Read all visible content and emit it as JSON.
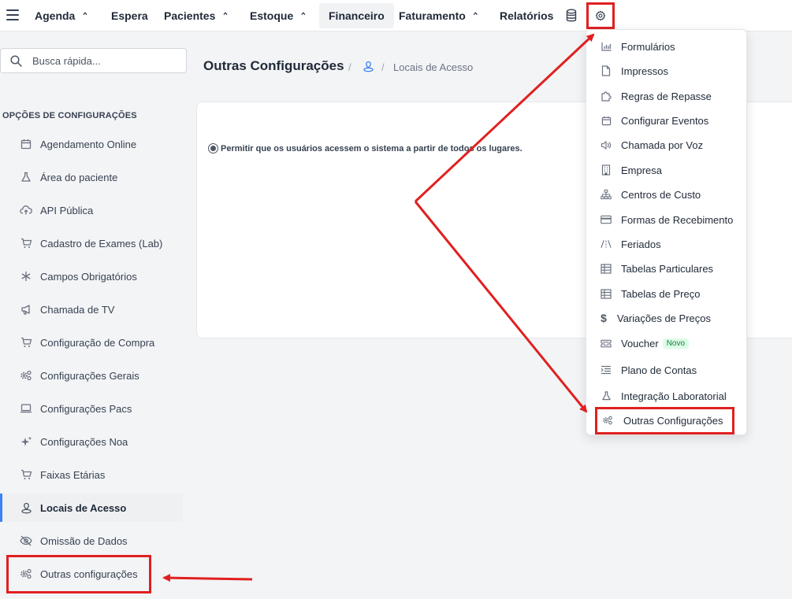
{
  "nav": {
    "items": [
      {
        "label": "Agenda",
        "chevron": true
      },
      {
        "label": "Espera",
        "chevron": false
      },
      {
        "label": "Pacientes",
        "chevron": true
      },
      {
        "label": "Estoque",
        "chevron": true
      },
      {
        "label": "Financeiro",
        "chevron": false
      },
      {
        "label": "Faturamento",
        "chevron": true
      },
      {
        "label": "Relatórios",
        "chevron": false
      }
    ],
    "active": "Financeiro"
  },
  "search": {
    "placeholder": "Busca rápida..."
  },
  "sidebar": {
    "section_title": "OPÇÕES DE CONFIGURAÇÕES",
    "items": [
      {
        "label": "Agendamento Online",
        "icon": "calendar-icon"
      },
      {
        "label": "Área do paciente",
        "icon": "flask-icon"
      },
      {
        "label": "API Pública",
        "icon": "cloud-upload-icon"
      },
      {
        "label": "Cadastro de Exames (Lab)",
        "icon": "cart-icon"
      },
      {
        "label": "Campos Obrigatórios",
        "icon": "asterisk-icon"
      },
      {
        "label": "Chamada de TV",
        "icon": "megaphone-icon"
      },
      {
        "label": "Configuração de Compra",
        "icon": "cart-icon"
      },
      {
        "label": "Configurações Gerais",
        "icon": "gears-icon"
      },
      {
        "label": "Configurações Pacs",
        "icon": "laptop-icon"
      },
      {
        "label": "Configurações Noa",
        "icon": "sparkles-icon"
      },
      {
        "label": "Faixas Etárias",
        "icon": "cart-icon"
      },
      {
        "label": "Locais de Acesso",
        "icon": "location-icon"
      },
      {
        "label": "Omissão de Dados",
        "icon": "eye-off-icon"
      },
      {
        "label": "Outras configurações",
        "icon": "gears-icon"
      }
    ],
    "active_index": 11
  },
  "page": {
    "title": "Outras Configurações",
    "breadcrumb_current": "Locais de Acesso",
    "radio_label": "Permitir que os usuários acessem o sistema a partir de todos os lugares.",
    "radio_selected": true
  },
  "dropdown": {
    "items": [
      {
        "label": "Formulários",
        "icon": "chart-icon"
      },
      {
        "label": "Impressos",
        "icon": "file-icon"
      },
      {
        "label": "Regras de Repasse",
        "icon": "puzzle-icon"
      },
      {
        "label": "Configurar Eventos",
        "icon": "calendar-icon"
      },
      {
        "label": "Chamada por Voz",
        "icon": "speaker-icon"
      },
      {
        "label": "Empresa",
        "icon": "building-icon"
      },
      {
        "label": "Centros de Custo",
        "icon": "sitemap-icon"
      },
      {
        "label": "Formas de Recebimento",
        "icon": "credit-card-icon"
      },
      {
        "label": "Feriados",
        "icon": "road-icon"
      },
      {
        "label": "Tabelas Particulares",
        "icon": "table-icon"
      },
      {
        "label": "Tabelas de Preço",
        "icon": "table-icon"
      },
      {
        "label": "Variações de Preços",
        "icon": "dollar-icon"
      },
      {
        "label": "Voucher",
        "icon": "ticket-icon",
        "badge": "Novo"
      },
      {
        "label": "Plano de Contas",
        "icon": "indent-icon"
      },
      {
        "label": "Integração Laboratorial",
        "icon": "flask-icon"
      },
      {
        "label": "Outras Configurações",
        "icon": "gears-icon"
      }
    ]
  },
  "colors": {
    "annotation": "#e02020",
    "active_border": "#3b82f6",
    "badge_bg": "#dcfce7"
  }
}
